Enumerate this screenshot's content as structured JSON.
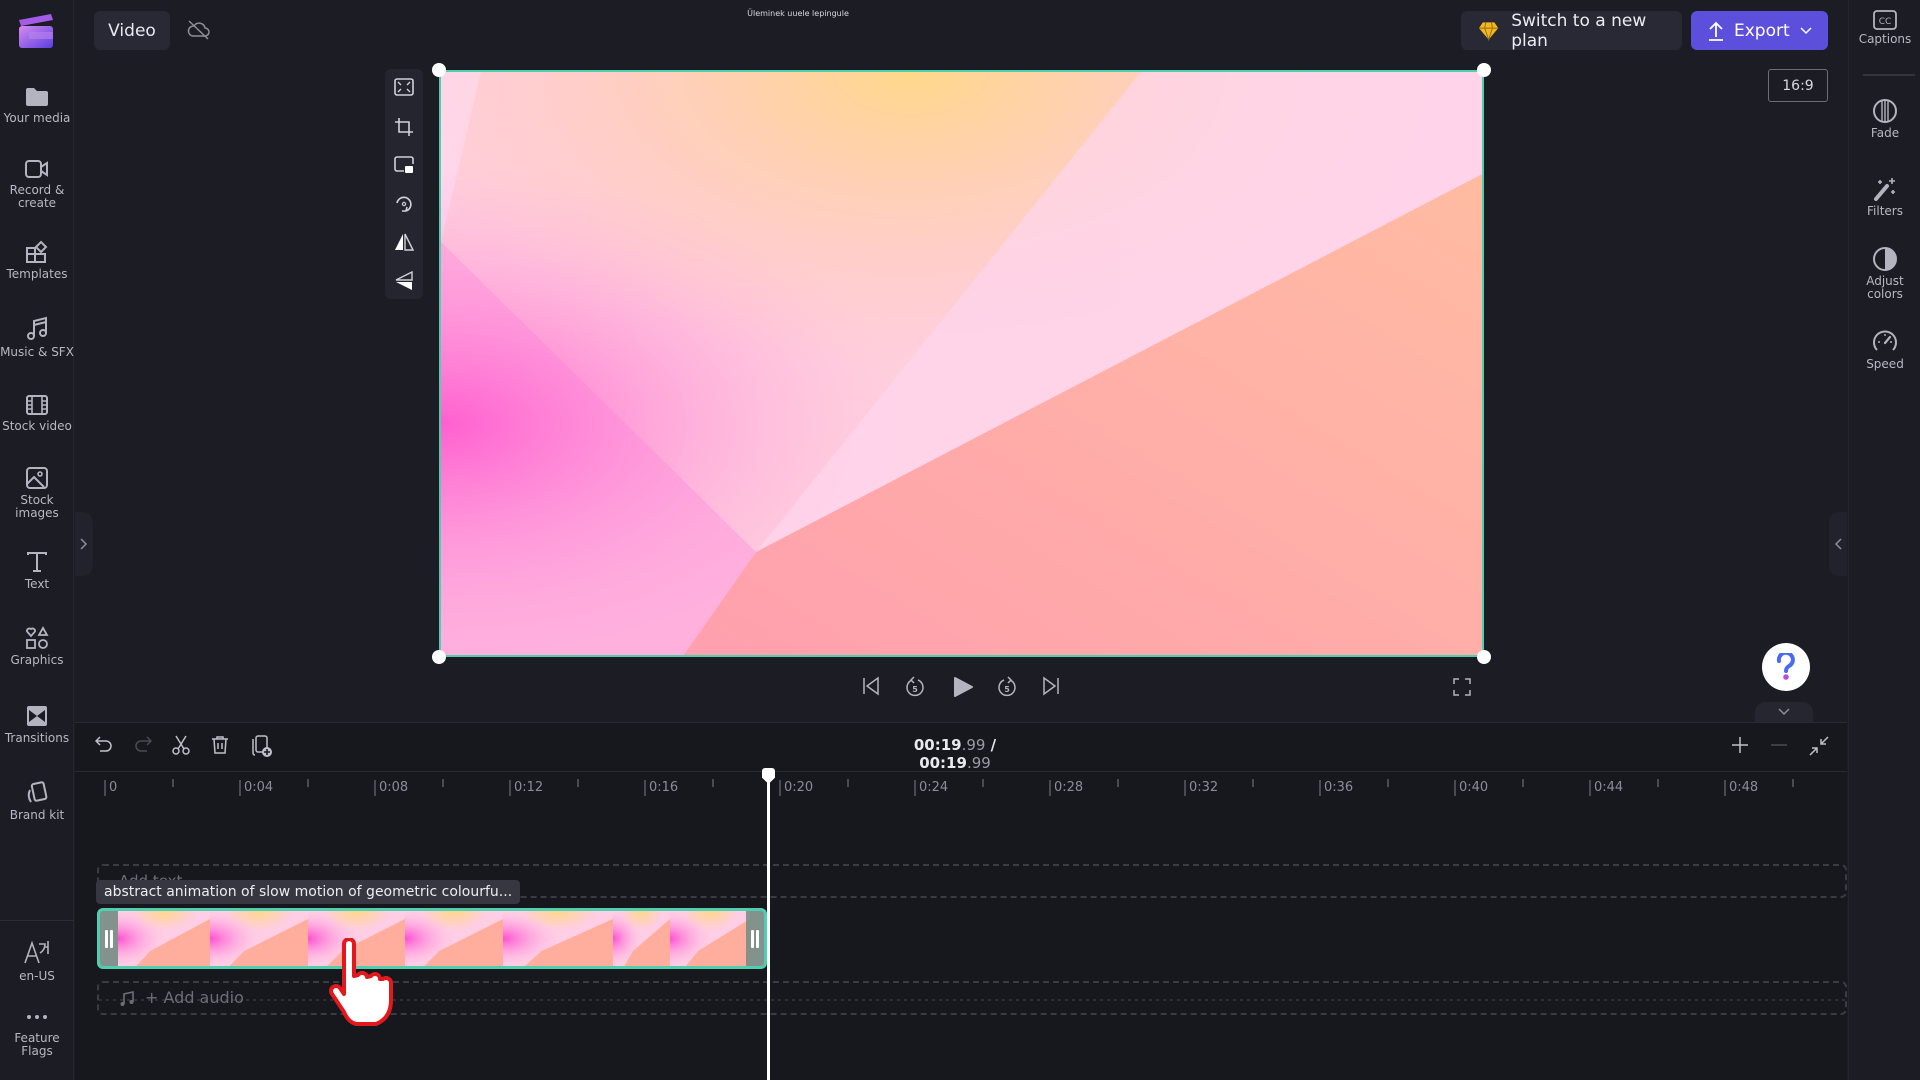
{
  "app": {
    "project_type": "Video",
    "top_tooltip": "Üleminek uuele lepingule",
    "accent_color": "#5b4fdb",
    "selection_color": "#4fcfb0"
  },
  "left_sidebar": {
    "items": [
      {
        "id": "your-media",
        "label": "Your media",
        "icon": "folder-icon"
      },
      {
        "id": "record-create",
        "label": "Record &",
        "label2": "create",
        "icon": "video-camera-icon"
      },
      {
        "id": "templates",
        "label": "Templates",
        "icon": "templates-icon"
      },
      {
        "id": "music-sfx",
        "label": "Music & SFX",
        "icon": "music-note-icon"
      },
      {
        "id": "stock-video",
        "label": "Stock video",
        "icon": "film-strip-icon"
      },
      {
        "id": "stock-images",
        "label": "Stock",
        "label2": "images",
        "icon": "image-icon"
      },
      {
        "id": "text",
        "label": "Text",
        "icon": "text-icon"
      },
      {
        "id": "graphics",
        "label": "Graphics",
        "icon": "shapes-icon"
      },
      {
        "id": "transitions",
        "label": "Transitions",
        "icon": "transitions-icon"
      },
      {
        "id": "brand-kit",
        "label": "Brand kit",
        "icon": "brand-kit-icon"
      }
    ],
    "bottom_items": [
      {
        "id": "language",
        "label": "en-US",
        "icon": "language-icon"
      },
      {
        "id": "feature-flags",
        "label": "Feature",
        "label2": "Flags",
        "icon": "more-icon"
      }
    ]
  },
  "header": {
    "plan_button": "Switch to a new plan",
    "export_button": "Export"
  },
  "right_sidebar": {
    "items": [
      {
        "id": "captions",
        "label": "Captions",
        "icon": "captions-icon"
      },
      {
        "id": "fade",
        "label": "Fade",
        "icon": "fade-icon"
      },
      {
        "id": "filters",
        "label": "Filters",
        "icon": "magic-wand-icon"
      },
      {
        "id": "adjust-colors",
        "label": "Adjust",
        "label2": "colors",
        "icon": "contrast-icon"
      },
      {
        "id": "speed",
        "label": "Speed",
        "icon": "speedometer-icon"
      }
    ]
  },
  "preview": {
    "aspect_ratio": "16:9",
    "tools": [
      "fit-icon",
      "crop-icon",
      "picture-in-picture-icon",
      "rotate-icon",
      "flip-horizontal-icon",
      "flip-vertical-icon"
    ],
    "skip_seconds": "5"
  },
  "timeline": {
    "current_time": "00:19",
    "current_frac": ".99",
    "separator": "/",
    "total_time": "00:19",
    "total_frac": ".99",
    "ruler_labels": [
      "0",
      "0:04",
      "0:08",
      "0:12",
      "0:16",
      "0:20",
      "0:24",
      "0:28",
      "0:32",
      "0:36",
      "0:40",
      "0:44",
      "0:48"
    ],
    "add_text_label": "Add text",
    "clip_title": "abstract animation of slow motion of geometric colourfu...",
    "add_audio_label": "+ Add audio",
    "playhead_seconds": 19.99
  }
}
